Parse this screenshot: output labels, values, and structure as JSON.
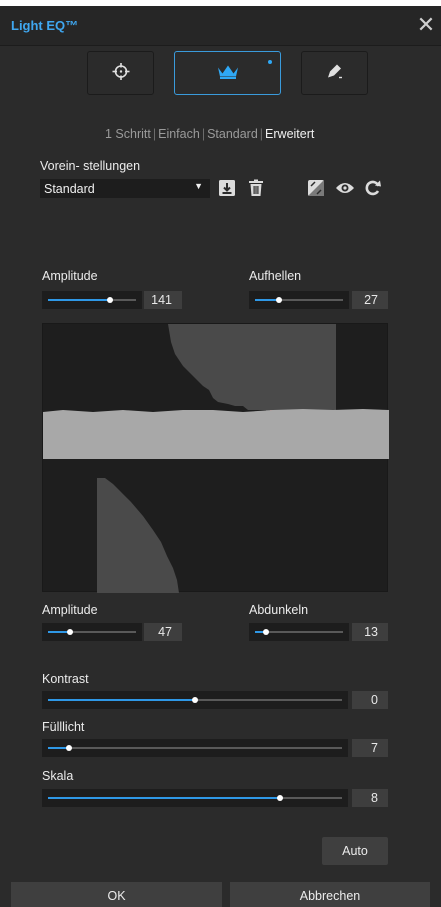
{
  "window": {
    "title": "Light EQ™",
    "close_glyph": "✕"
  },
  "modes": [
    {
      "icon": "crosshair-icon",
      "active": false
    },
    {
      "icon": "crown-icon",
      "active": true
    },
    {
      "icon": "pen-icon",
      "active": false
    }
  ],
  "levels": {
    "items": [
      "1 Schritt",
      "Einfach",
      "Standard",
      "Erweitert"
    ],
    "separator": "|",
    "current": "Erweitert"
  },
  "presets": {
    "label": "Vorein- stellungen",
    "selected": "Standard",
    "icons": [
      "save-icon",
      "trash-icon",
      "compare-icon",
      "eye-icon",
      "reset-icon"
    ]
  },
  "highlights": {
    "amplitude": {
      "label": "Amplitude",
      "value": "141",
      "fraction": 0.7
    },
    "brighten": {
      "label": "Aufhellen",
      "value": "27",
      "fraction": 0.27
    }
  },
  "shadows": {
    "amplitude": {
      "label": "Amplitude",
      "value": "47",
      "fraction": 0.25
    },
    "darken": {
      "label": "Abdunkeln",
      "value": "13",
      "fraction": 0.13
    }
  },
  "contrast": {
    "label": "Kontrast",
    "value": "0",
    "fraction": 0.5
  },
  "fill_light": {
    "label": "Fülllicht",
    "value": "7",
    "fraction": 0.07
  },
  "scale": {
    "label": "Skala",
    "value": "8",
    "fraction": 0.79
  },
  "buttons": {
    "auto": "Auto",
    "ok": "OK",
    "cancel": "Abbrechen"
  },
  "colors": {
    "accent": "#2f98e6",
    "title": "#3fa7f0",
    "clip": "#d16969"
  }
}
